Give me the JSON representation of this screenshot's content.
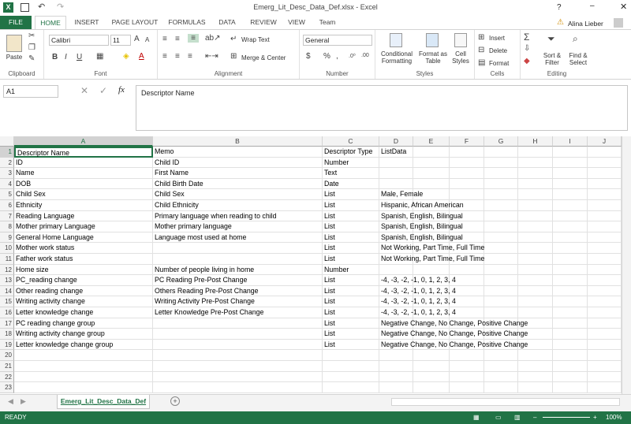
{
  "window": {
    "title": "Emerg_Lit_Desc_Data_Def.xlsx - Excel",
    "user": "Alina Lieber",
    "help": "?"
  },
  "tabs": [
    "FILE",
    "HOME",
    "INSERT",
    "PAGE LAYOUT",
    "FORMULAS",
    "DATA",
    "REVIEW",
    "VIEW",
    "Team"
  ],
  "ribbon": {
    "clipboard": {
      "label": "Clipboard",
      "paste": "Paste"
    },
    "font": {
      "label": "Font",
      "name": "Calibri",
      "size": "11",
      "bold": "B",
      "italic": "I",
      "underline": "U"
    },
    "alignment": {
      "label": "Alignment",
      "wrap": "Wrap Text",
      "merge": "Merge & Center"
    },
    "number": {
      "label": "Number",
      "format": "General",
      "currency": "$",
      "percent": "%",
      "comma": ","
    },
    "styles": {
      "label": "Styles",
      "cond": "Conditional Formatting",
      "table": "Format as Table",
      "cell": "Cell Styles"
    },
    "cells": {
      "label": "Cells",
      "insert": "Insert",
      "delete": "Delete",
      "format": "Format"
    },
    "editing": {
      "label": "Editing",
      "sort": "Sort & Filter",
      "find": "Find & Select"
    }
  },
  "formula_bar": {
    "name_box": "A1",
    "content": "Descriptor Name",
    "fx": "fx"
  },
  "columns": [
    "A",
    "B",
    "C",
    "D",
    "E",
    "F",
    "G",
    "H",
    "I",
    "J"
  ],
  "rows": [
    [
      "Descriptor Name",
      "Memo",
      "Descriptor Type",
      "ListData"
    ],
    [
      "ID",
      "Child ID",
      "Number",
      ""
    ],
    [
      "Name",
      "First Name",
      "Text",
      ""
    ],
    [
      "DOB",
      "Child Birth Date",
      "Date",
      ""
    ],
    [
      "Child Sex",
      "Child Sex",
      "List",
      "Male, Female"
    ],
    [
      "Ethnicity",
      "Child Ethnicity",
      "List",
      "Hispanic, African American"
    ],
    [
      "Reading Language",
      "Primary language when reading to child",
      "List",
      "Spanish, English, Bilingual"
    ],
    [
      "Mother primary Language",
      "Mother primary language",
      "List",
      "Spanish, English, Bilingual"
    ],
    [
      "General Home Language",
      "Language most used at home",
      "List",
      "Spanish, English, Bilingual"
    ],
    [
      "Mother work status",
      "",
      "List",
      "Not Working, Part Time, Full Time"
    ],
    [
      "Father work status",
      "",
      "List",
      "Not Working, Part Time, Full Time"
    ],
    [
      "Home size",
      "Number of people living in home",
      "Number",
      ""
    ],
    [
      "PC_reading change",
      "PC Reading Pre-Post Change",
      "List",
      "-4, -3, -2, -1, 0, 1, 2, 3, 4"
    ],
    [
      "Other reading change",
      "Others Reading Pre-Post Change",
      "List",
      "-4, -3, -2, -1, 0, 1, 2, 3, 4"
    ],
    [
      "Writing activity change",
      "Writing Activity Pre-Post Change",
      "List",
      "-4, -3, -2, -1, 0, 1, 2, 3, 4"
    ],
    [
      "Letter knowledge change",
      "Letter Knowledge Pre-Post Change",
      "List",
      "-4, -3, -2, -1, 0, 1, 2, 3, 4"
    ],
    [
      "PC reading change group",
      "",
      "List",
      "Negative Change, No Change, Positive Change"
    ],
    [
      "Writing activity change group",
      "",
      "List",
      "Negative Change, No Change, Positive Change"
    ],
    [
      "Letter knowledge change group",
      "",
      "List",
      "Negative Change, No Change, Positive Change"
    ],
    [
      "",
      "",
      "",
      ""
    ],
    [
      "",
      "",
      "",
      ""
    ],
    [
      "",
      "",
      "",
      ""
    ],
    [
      "",
      "",
      "",
      ""
    ]
  ],
  "sheet": {
    "name": "Emerg_Lit_Desc_Data_Def"
  },
  "status": {
    "ready": "READY",
    "zoom": "100%"
  },
  "accent": "#217346"
}
